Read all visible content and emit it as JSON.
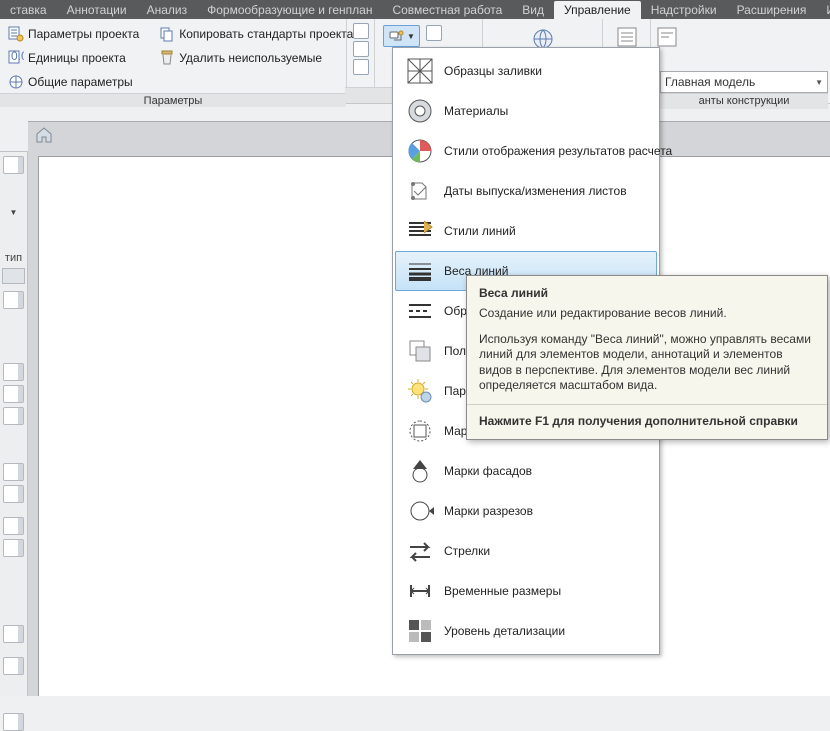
{
  "tabs": [
    "ставка",
    "Аннотации",
    "Анализ",
    "Формообразующие и генплан",
    "Совместная работа",
    "Вид",
    "Управление",
    "Надстройки",
    "Расширения",
    "И"
  ],
  "active_tab_index": 6,
  "ribbon": {
    "panel1": {
      "r1": "Параметры проекта",
      "r2": "Единицы проекта",
      "r3": "Общие параметры",
      "r4": "Копировать стандарты проекта",
      "r5": "Удалить неиспользуемые",
      "title": "Параметры"
    }
  },
  "combo": {
    "value": "Главная модель"
  },
  "right_label": "анты конструкции",
  "menu": [
    "Образцы заливки",
    "Материалы",
    "Стили отображения результатов расчета",
    "Даты выпуска/изменения листов",
    "Стили линий",
    "Веса линий",
    "Образцы линий",
    "Полутона/подложки",
    "Параметры солнца",
    "Марки фрагментов",
    "Марки фасадов",
    "Марки разрезов",
    "Стрелки",
    "Временные размеры",
    "Уровень детализации"
  ],
  "menu_cut": {
    "6": "Образц",
    "7": "Полуто",
    "8": "Парам",
    "9": "Марки ф"
  },
  "menu_hover_index": 5,
  "tooltip": {
    "title": "Веса линий",
    "summary": "Создание или редактирование весов линий.",
    "body": "Используя команду \"Веса линий\", можно управлять весами линий для элементов модели, аннотаций и элементов видов в перспективе. Для элементов модели вес линий определяется масштабом вида.",
    "footer": "Нажмите F1 для получения дополнительной справки"
  },
  "left_label": "тип"
}
